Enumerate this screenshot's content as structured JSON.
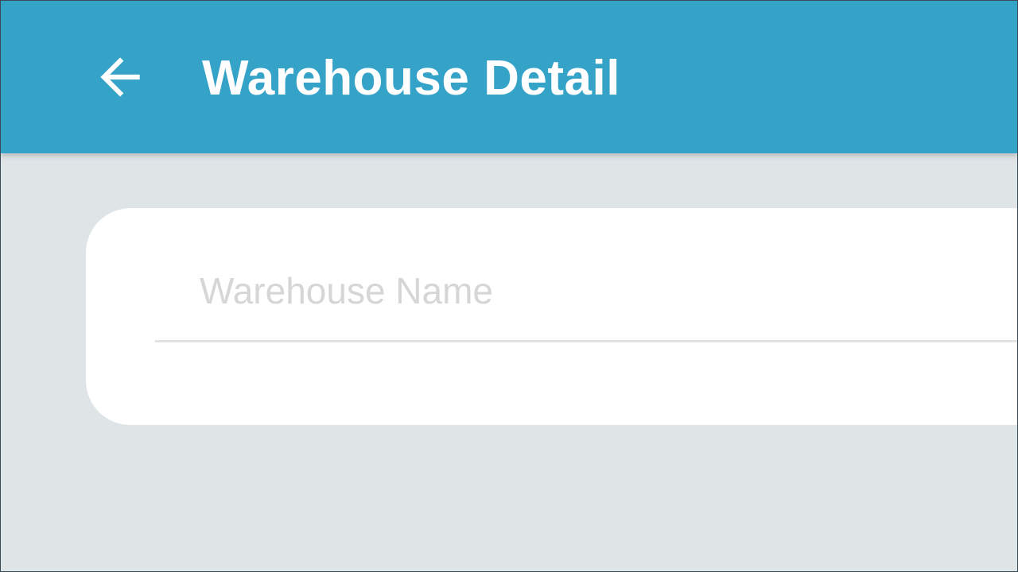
{
  "app_bar": {
    "title": "Warehouse Detail",
    "back_icon": "arrow-left-icon",
    "background_color": "#35a2c8",
    "text_color": "#ffffff"
  },
  "form": {
    "warehouse_name": {
      "value": "",
      "placeholder": "Warehouse Name"
    }
  },
  "colors": {
    "page_background": "#dfe4e7",
    "card_background": "#ffffff",
    "placeholder": "#d6d6d6",
    "underline": "#e2e2e2"
  }
}
